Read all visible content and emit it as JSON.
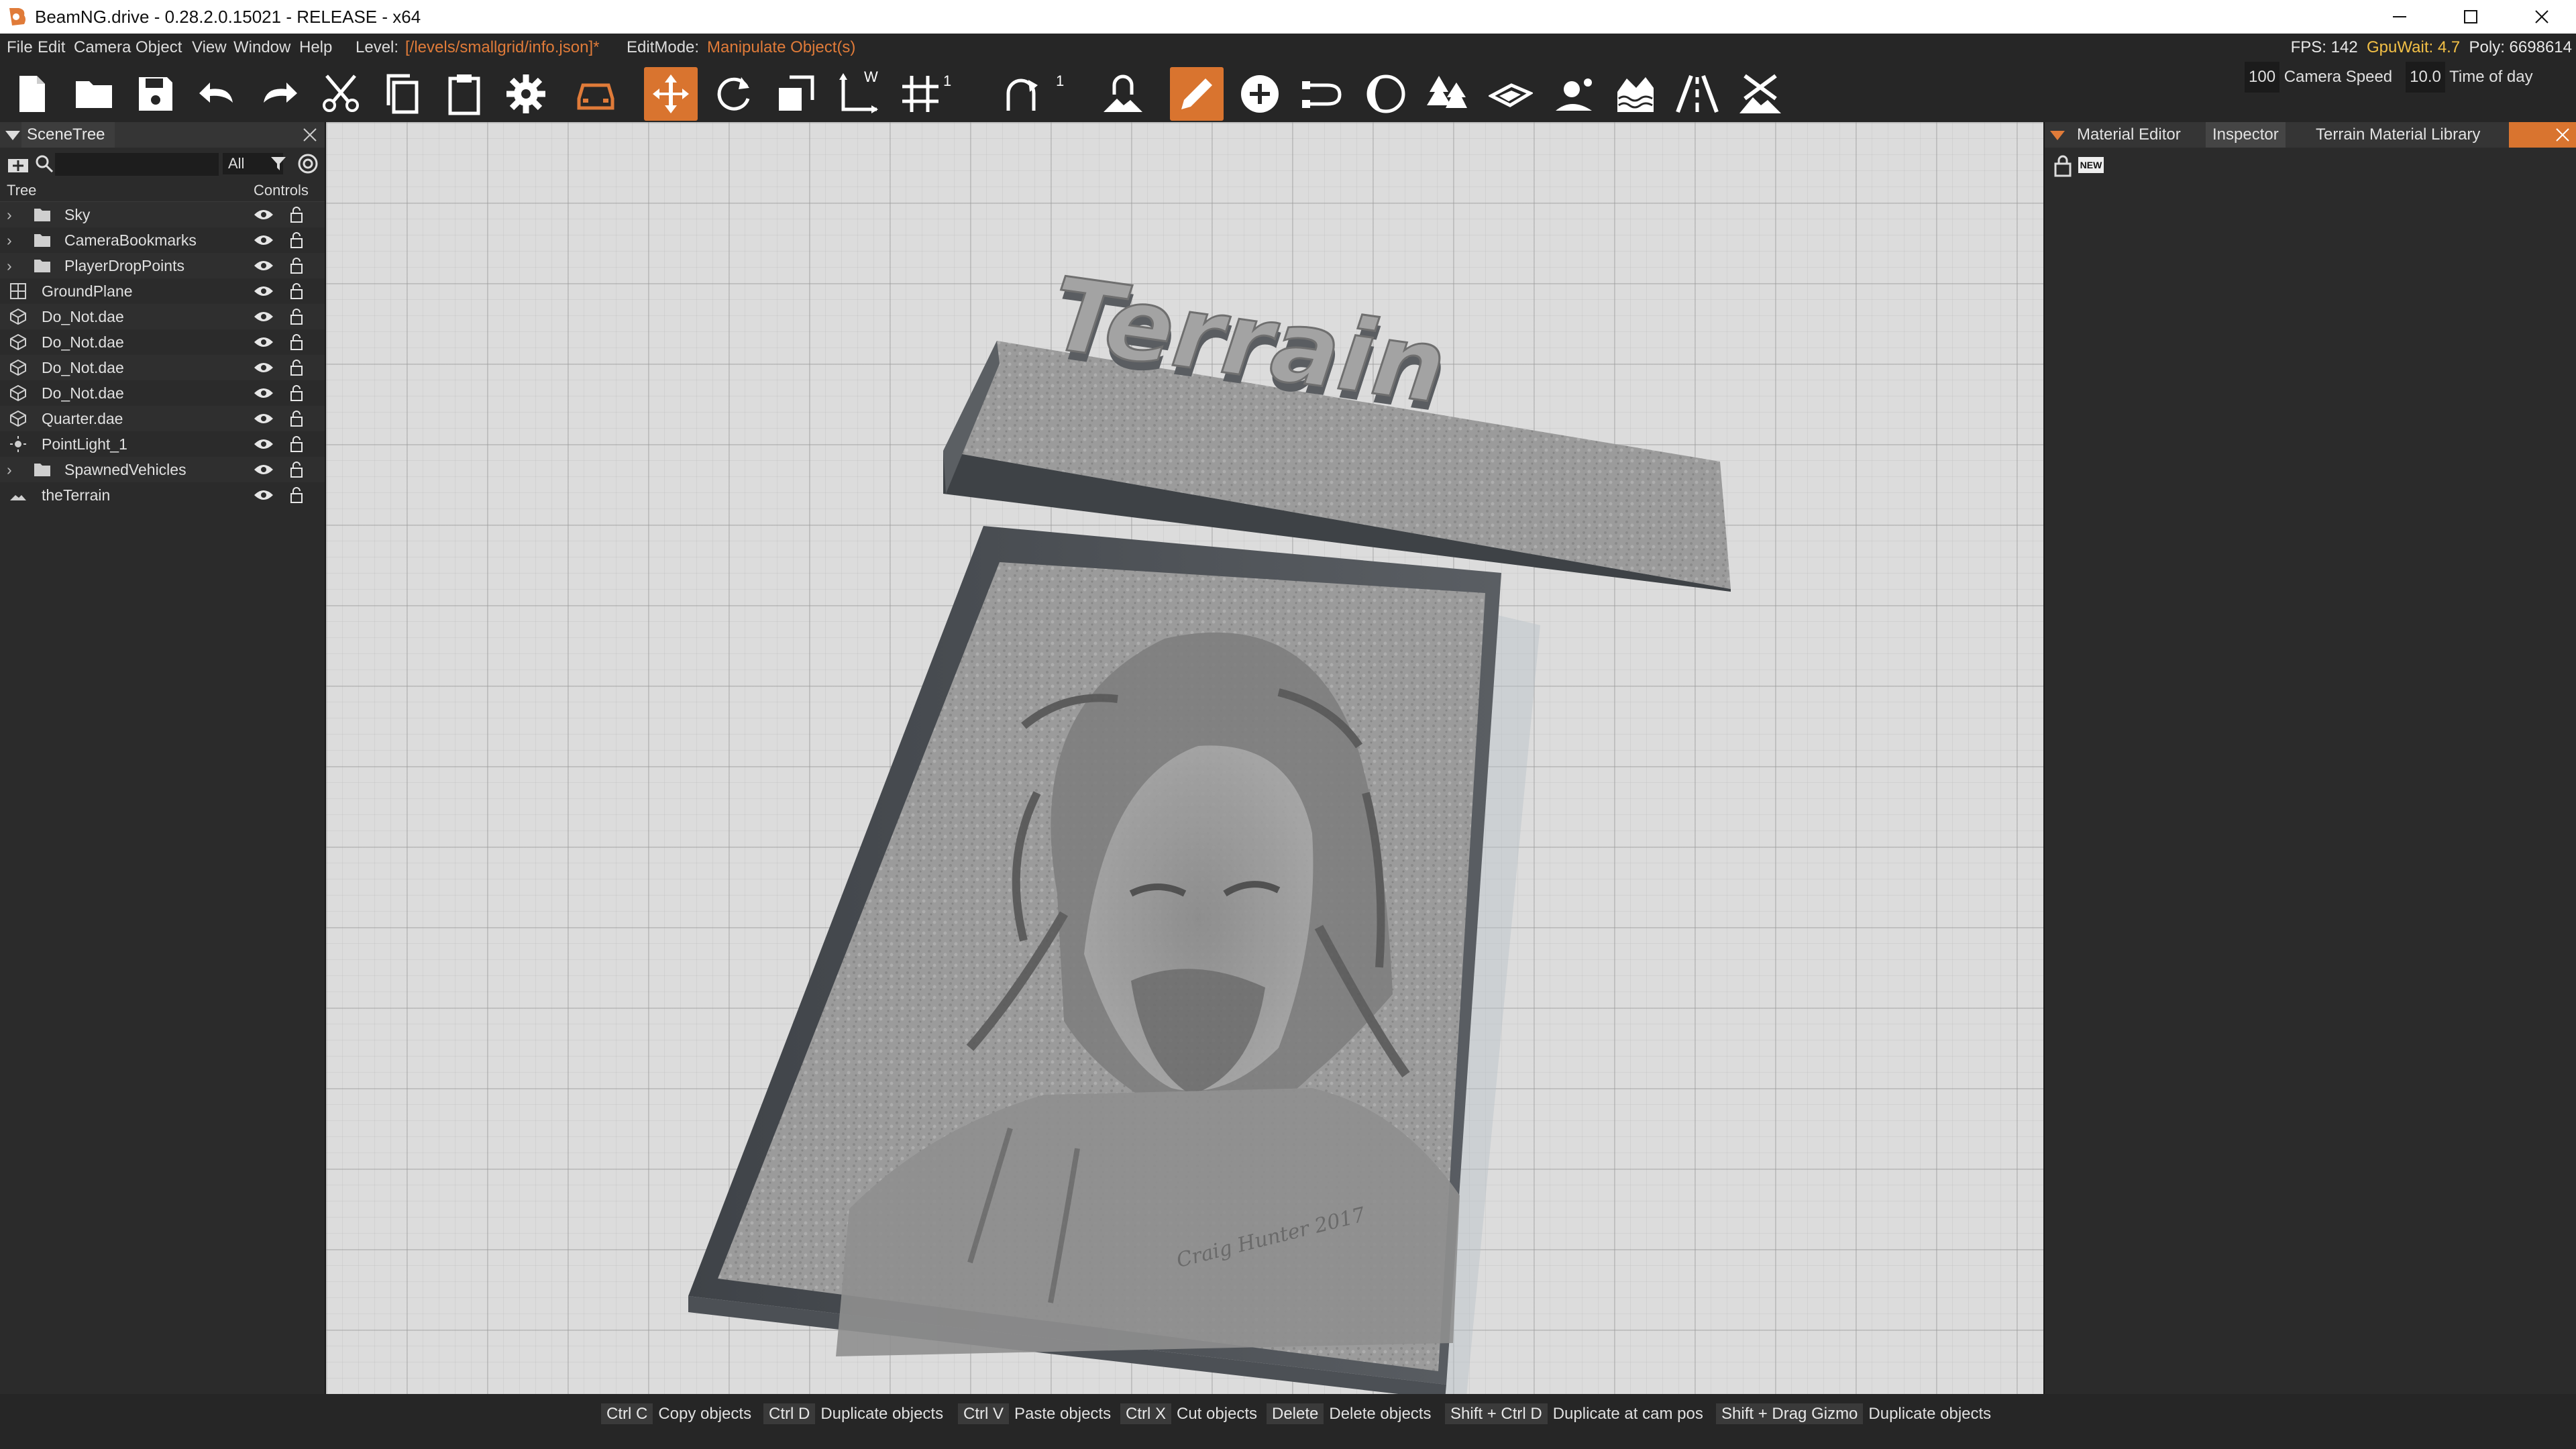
{
  "window": {
    "title": "BeamNG.drive - 0.28.2.0.15021 - RELEASE - x64",
    "minimize_icon": "minimize-icon",
    "maximize_icon": "maximize-icon",
    "close_icon": "close-icon"
  },
  "menubar": {
    "items": [
      "File",
      "Edit",
      "Camera",
      "Object",
      "View",
      "Window",
      "Help"
    ],
    "level_label": "Level:",
    "level_value": "[/levels/smallgrid/info.json]*",
    "editmode_label": "EditMode:",
    "editmode_value": "Manipulate Object(s)",
    "fps_label": "FPS: 142",
    "gpuwait_label": "GpuWait: 4.7",
    "poly_label": "Poly: 6698614"
  },
  "toolbar": {
    "icons": [
      "new-file-icon",
      "open-folder-icon",
      "save-icon",
      "undo-icon",
      "redo-icon",
      "cut-icon",
      "copy-icon",
      "paste-icon",
      "settings-icon",
      "vehicle-icon",
      "translate-icon",
      "rotate-icon",
      "scale-icon",
      "world-axis-icon",
      "snap-grid-icon",
      "rotation-snap-icon",
      "terrain-snap-icon",
      "edit-pencil-icon",
      "add-object-icon",
      "road-tool-icon",
      "time-of-day-icon",
      "forest-icon",
      "decal-icon",
      "sculpt-icon",
      "water-icon",
      "road-lane-icon",
      "terrain-tool-icon"
    ],
    "axis_label": "W",
    "snap_value_1": "1",
    "snap_value_2": "1",
    "camera_speed_value": "100",
    "camera_speed_label": "Camera Speed",
    "time_value": "10.0",
    "time_label": "Time of day"
  },
  "scenetree": {
    "panel_title": "SceneTree",
    "search_placeholder": "",
    "filter_value": "All",
    "col_tree": "Tree",
    "col_controls": "Controls",
    "rows": [
      {
        "label": "Sky",
        "type": "folder",
        "expandable": true
      },
      {
        "label": "CameraBookmarks",
        "type": "folder",
        "expandable": true
      },
      {
        "label": "PlayerDropPoints",
        "type": "folder",
        "expandable": true
      },
      {
        "label": "GroundPlane",
        "type": "grid",
        "expandable": false
      },
      {
        "label": "Do_Not.dae",
        "type": "mesh",
        "expandable": false
      },
      {
        "label": "Do_Not.dae",
        "type": "mesh",
        "expandable": false
      },
      {
        "label": "Do_Not.dae",
        "type": "mesh",
        "expandable": false
      },
      {
        "label": "Do_Not.dae",
        "type": "mesh",
        "expandable": false
      },
      {
        "label": "Quarter.dae",
        "type": "mesh",
        "expandable": false
      },
      {
        "label": "PointLight_1",
        "type": "light",
        "expandable": false
      },
      {
        "label": "SpawnedVehicles",
        "type": "folder",
        "expandable": true
      },
      {
        "label": "theTerrain",
        "type": "terrain",
        "expandable": false
      }
    ]
  },
  "viewport": {
    "sign_text": "Terrain",
    "relief_signature": "Craig Hunter 2017"
  },
  "rightpanel": {
    "tabs": [
      "Material Editor",
      "Inspector",
      "Terrain Material Library"
    ],
    "active_tab": "Inspector",
    "new_badge": "NEW"
  },
  "statusbar": {
    "shortcuts": [
      {
        "key": "Ctrl C",
        "desc": "Copy objects"
      },
      {
        "key": "Ctrl D",
        "desc": "Duplicate objects"
      },
      {
        "key": "Ctrl V",
        "desc": "Paste objects"
      },
      {
        "key": "Ctrl X",
        "desc": "Cut objects"
      },
      {
        "key": "Delete",
        "desc": "Delete objects"
      },
      {
        "key": "Shift + Ctrl D",
        "desc": "Duplicate at cam pos"
      },
      {
        "key": "Shift + Drag Gizmo",
        "desc": "Duplicate objects"
      }
    ]
  },
  "colors": {
    "accent": "#d9742f",
    "panel_bg": "#2b2b2b",
    "viewport_bg": "#dcdcdc",
    "warn": "#f3c046"
  }
}
